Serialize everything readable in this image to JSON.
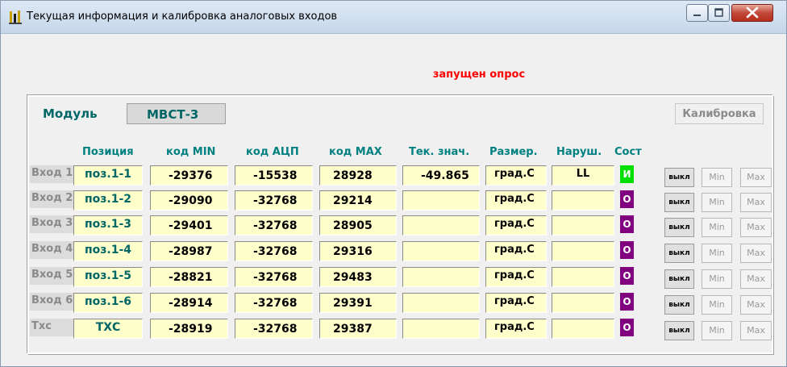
{
  "window": {
    "title": "Текущая информация и калибровка аналоговых входов",
    "icon": "app-bars-icon"
  },
  "status_text": "запущен опрос",
  "module": {
    "label": "Модуль",
    "value": "МВСТ-3"
  },
  "calibration_label": "Калибровка",
  "columns": {
    "position": "Позиция",
    "code_min": "код MIN",
    "code_adc": "код  АЦП",
    "code_max": "код MAX",
    "current": "Тек. знач.",
    "unit": "Размер.",
    "fault": "Наруш.",
    "state": "Сост"
  },
  "rows": [
    {
      "label": "Вход 1",
      "position": "поз.1-1",
      "code_min": "-29376",
      "code_adc": "-15538",
      "code_max": "28928",
      "current": "-49.865",
      "unit": "град.С",
      "fault": "LL",
      "state": "И",
      "state_color": "#00e000",
      "btn_off": "выкл",
      "btn_min": "Min",
      "btn_max": "Max"
    },
    {
      "label": "Вход 2",
      "position": "поз.1-2",
      "code_min": "-29090",
      "code_adc": "-32768",
      "code_max": "29214",
      "current": "",
      "unit": "град.С",
      "fault": "",
      "state": "О",
      "state_color": "#800080",
      "btn_off": "выкл",
      "btn_min": "Min",
      "btn_max": "Max"
    },
    {
      "label": "Вход 3",
      "position": "поз.1-3",
      "code_min": "-29401",
      "code_adc": "-32768",
      "code_max": "28905",
      "current": "",
      "unit": "град.С",
      "fault": "",
      "state": "О",
      "state_color": "#800080",
      "btn_off": "выкл",
      "btn_min": "Min",
      "btn_max": "Max"
    },
    {
      "label": "Вход 4",
      "position": "поз.1-4",
      "code_min": "-28987",
      "code_adc": "-32768",
      "code_max": "29316",
      "current": "",
      "unit": "град.С",
      "fault": "",
      "state": "О",
      "state_color": "#800080",
      "btn_off": "выкл",
      "btn_min": "Min",
      "btn_max": "Max"
    },
    {
      "label": "Вход 5",
      "position": "поз.1-5",
      "code_min": "-28821",
      "code_adc": "-32768",
      "code_max": "29483",
      "current": "",
      "unit": "град.С",
      "fault": "",
      "state": "О",
      "state_color": "#800080",
      "btn_off": "выкл",
      "btn_min": "Min",
      "btn_max": "Max"
    },
    {
      "label": "Вход 6",
      "position": "поз.1-6",
      "code_min": "-28914",
      "code_adc": "-32768",
      "code_max": "29391",
      "current": "",
      "unit": "град.С",
      "fault": "",
      "state": "О",
      "state_color": "#800080",
      "btn_off": "выкл",
      "btn_min": "Min",
      "btn_max": "Max"
    },
    {
      "label": "Тхс",
      "position": "ТХС",
      "code_min": "-28919",
      "code_adc": "-32768",
      "code_max": "29387",
      "current": "",
      "unit": "град.С",
      "fault": "",
      "state": "О",
      "state_color": "#800080",
      "btn_off": "выкл",
      "btn_min": "Min",
      "btn_max": "Max"
    }
  ]
}
